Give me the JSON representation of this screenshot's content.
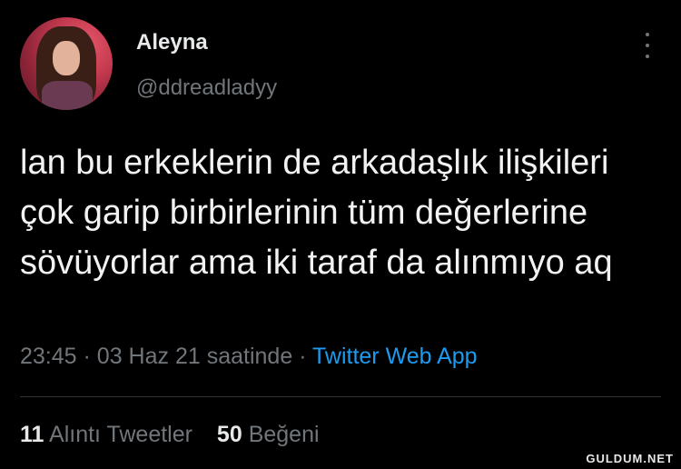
{
  "author": {
    "name": "Aleyna",
    "handle": "@ddreadladyy"
  },
  "tweet": {
    "text": "lan bu erkeklerin de arkadaşlık ilişkileri çok garip birbirlerinin tüm değerlerine sövüyorlar ama iki taraf da alınmıyo aq",
    "time": "23:45",
    "date": "03 Haz 21 saatinde",
    "separator": "·",
    "source": "Twitter Web App"
  },
  "stats": {
    "quotes_count": "11",
    "quotes_label": "Alıntı Tweetler",
    "likes_count": "50",
    "likes_label": "Beğeni"
  },
  "watermark": "GULDUM.NET",
  "colors": {
    "background": "#000000",
    "secondary_text": "#71767b",
    "link": "#1d9bf0"
  },
  "icons": {
    "more": "vertical-ellipsis-icon"
  }
}
